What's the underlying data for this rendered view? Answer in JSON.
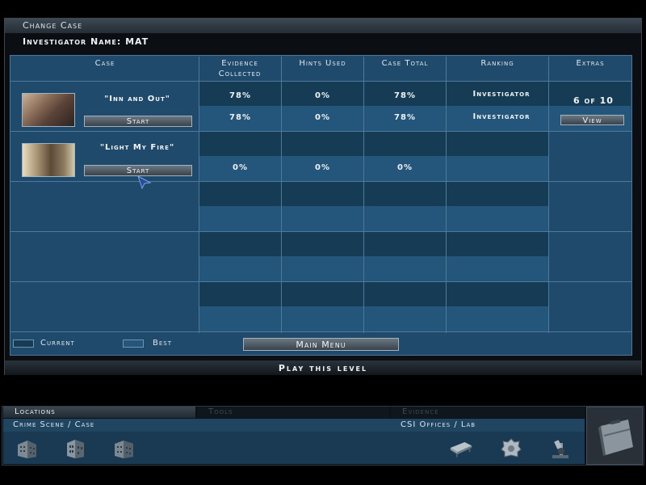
{
  "window": {
    "title": "Change Case",
    "investigator": "Investigator Name: MAT"
  },
  "table": {
    "headers": {
      "case": "Case",
      "evidence": "Evidence Collected",
      "hints": "Hints Used",
      "total": "Case Total",
      "ranking": "Ranking",
      "extras": "Extras"
    },
    "cases": [
      {
        "name": "\"Inn and Out\"",
        "start": "Start",
        "current": {
          "evidence": "78%",
          "hints": "0%",
          "total": "78%",
          "ranking": "Investigator"
        },
        "best": {
          "evidence": "78%",
          "hints": "0%",
          "total": "78%",
          "ranking": "Investigator"
        },
        "extras": "6 of 10",
        "view": "View"
      },
      {
        "name": "\"Light My Fire\"",
        "start": "Start",
        "current": {
          "evidence": "",
          "hints": "",
          "total": "",
          "ranking": ""
        },
        "best": {
          "evidence": "0%",
          "hints": "0%",
          "total": "0%",
          "ranking": ""
        }
      }
    ]
  },
  "legend": {
    "current": "Current",
    "best": "Best"
  },
  "main_menu": "Main Menu",
  "status": "Play this level",
  "bottom": {
    "tabs": [
      "Locations",
      "Tools",
      "Evidence"
    ],
    "crime_scene": "Crime Scene / Case",
    "csi_offices": "CSI Offices / Lab",
    "icons": [
      "building-icon",
      "building-icon",
      "building-icon",
      "autopsy-table-icon",
      "badge-icon",
      "microscope-icon",
      "briefcase-icon"
    ]
  },
  "colors": {
    "panel": "#1f4a6b",
    "current_cell": "#163c55",
    "best_cell": "#24557a"
  }
}
